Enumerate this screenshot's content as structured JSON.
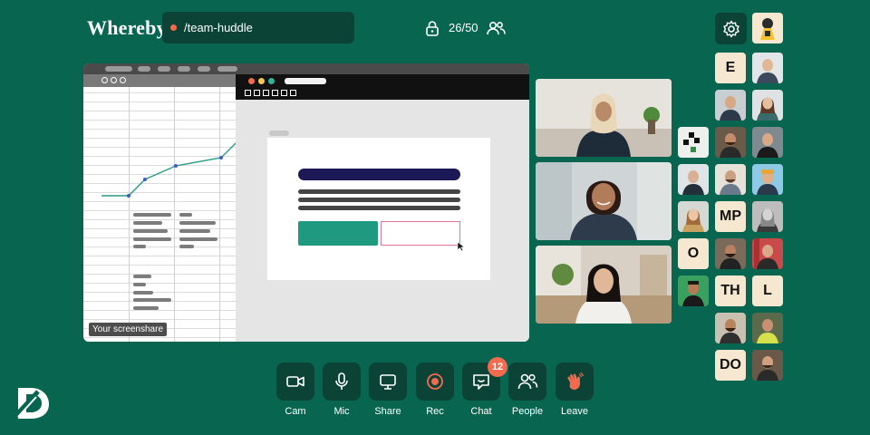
{
  "header": {
    "logo": "Whereby",
    "room_name": "/team-huddle",
    "participant_count": "26/50",
    "icons": [
      "lock-icon",
      "people-icon",
      "gear-icon"
    ],
    "status_dot_color": "#f26b4f"
  },
  "screenshare": {
    "label": "Your screenshare"
  },
  "participants": {
    "letter_tiles": [
      "E",
      "MP",
      "O",
      "TH",
      "L",
      "DO"
    ]
  },
  "controls": [
    {
      "label": "Cam",
      "icon": "camera-icon"
    },
    {
      "label": "Mic",
      "icon": "microphone-icon"
    },
    {
      "label": "Share",
      "icon": "screen-share-icon"
    },
    {
      "label": "Rec",
      "icon": "record-icon"
    },
    {
      "label": "Chat",
      "icon": "chat-icon",
      "badge": "12"
    },
    {
      "label": "People",
      "icon": "people-icon"
    },
    {
      "label": "Leave",
      "icon": "wave-hand-icon"
    }
  ],
  "colors": {
    "background": "#086650",
    "control_bg": "#0b4336",
    "accent": "#f26b4f",
    "tile_bg": "#f6e8d0"
  }
}
